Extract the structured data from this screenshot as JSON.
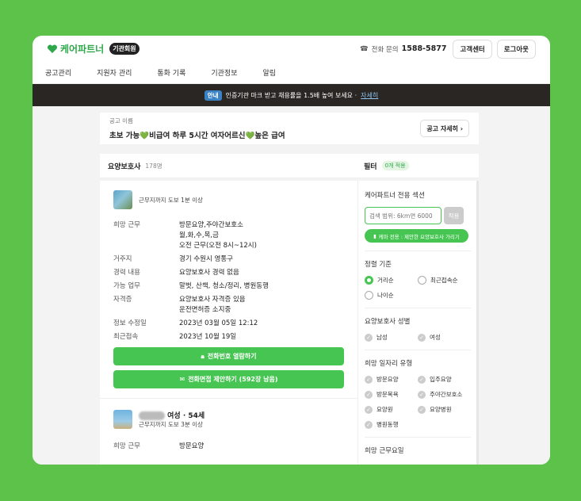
{
  "brand": {
    "name": "케어파트너",
    "badge": "기관회원"
  },
  "topbar": {
    "phone_label": "전화 문의",
    "phone_number": "1588-5877",
    "support_button": "고객센터",
    "logout_button": "로그아웃"
  },
  "menu": [
    "공고관리",
    "지원자 관리",
    "통화 기록",
    "기관정보",
    "알림"
  ],
  "notice": {
    "tag": "안내",
    "text": "인증기관 마크 받고 채용률을 1.5배 높여 보세요 ·",
    "link": "자세히"
  },
  "ad": {
    "small_label": "공고 이름",
    "title": "초보 가능💚비급여 하루 5시간 여자어르신💚높은 급여",
    "detail_button": "공고 자세히"
  },
  "list": {
    "title": "요양보호사",
    "count": "178명",
    "filter_title": "필터",
    "filter_count": "0개 적용"
  },
  "card1": {
    "distance": "근무지까지 도보 1분 이상",
    "rows": [
      {
        "k": "희망 근무",
        "v": [
          "방문요양,주야간보호소",
          "월,화,수,목,금",
          "오전 근무(오전 8시~12시)"
        ]
      },
      {
        "k": "거주지",
        "v": [
          "경기 수원시 영통구"
        ]
      },
      {
        "k": "경력 내용",
        "v": [
          "요양보호사 경력 없음"
        ]
      },
      {
        "k": "가능 업무",
        "v": [
          "말벗, 산책, 청소/정리, 병원동행"
        ]
      },
      {
        "k": "자격증",
        "v": [
          "요양보호사 자격증 있음",
          "운전면허증 소지중"
        ]
      },
      {
        "k": "정보 수정일",
        "v": [
          "2023년 03월 05일 12:12"
        ]
      },
      {
        "k": "최근접속",
        "v": [
          "2023년 10월 19일"
        ]
      }
    ],
    "btn_phone": "전화번호 열람하기",
    "btn_propose": "전화면접 제안하기 (592장 남음)"
  },
  "card2": {
    "meta": "여성 · 54세",
    "distance": "근무지까지 도보 3분 이상",
    "row_k": "희망 근무",
    "row_v": "방문요양"
  },
  "filter": {
    "exclusive_title": "케어파트너 전용 섹션",
    "search_placeholder": "검색 범위: 6km면 6000",
    "apply": "적용",
    "proposal_pill": "케마 전용 : 제안한 요양보호사 가리기",
    "sort_title": "정렬 기준",
    "sort_options": [
      "거리순",
      "최근접속순",
      "나이순"
    ],
    "gender_title": "요양보호사 성별",
    "gender_options": [
      "남성",
      "여성"
    ],
    "job_title": "희망 일자리 유형",
    "job_options": [
      "방문요양",
      "입주요양",
      "방문목욕",
      "주야간보호소",
      "요양원",
      "요양병원",
      "병원동행"
    ],
    "day_title": "희망 근무요일"
  },
  "colors": {
    "green": "#47c552",
    "background": "#5cc24a",
    "notice_bg": "#2a2623"
  }
}
